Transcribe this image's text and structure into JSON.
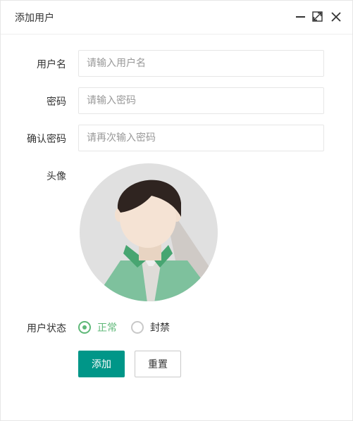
{
  "dialog": {
    "title": "添加用户"
  },
  "form": {
    "username": {
      "label": "用户名",
      "value": "",
      "placeholder": "请输入用户名"
    },
    "password": {
      "label": "密码",
      "value": "",
      "placeholder": "请输入密码"
    },
    "confirm_password": {
      "label": "确认密码",
      "value": "",
      "placeholder": "请再次输入密码"
    },
    "avatar": {
      "label": "头像"
    },
    "status": {
      "label": "用户状态",
      "options": [
        {
          "label": "正常",
          "checked": true
        },
        {
          "label": "封禁",
          "checked": false
        }
      ]
    }
  },
  "actions": {
    "add": "添加",
    "reset": "重置"
  },
  "icons": {
    "minimize": "minimize-icon",
    "maximize": "maximize-icon",
    "close": "close-icon"
  },
  "colors": {
    "primary": "#009688",
    "radio_active": "#5fb878",
    "avatar_bg": "#e0e0e0",
    "shirt": "#7ec19d"
  }
}
